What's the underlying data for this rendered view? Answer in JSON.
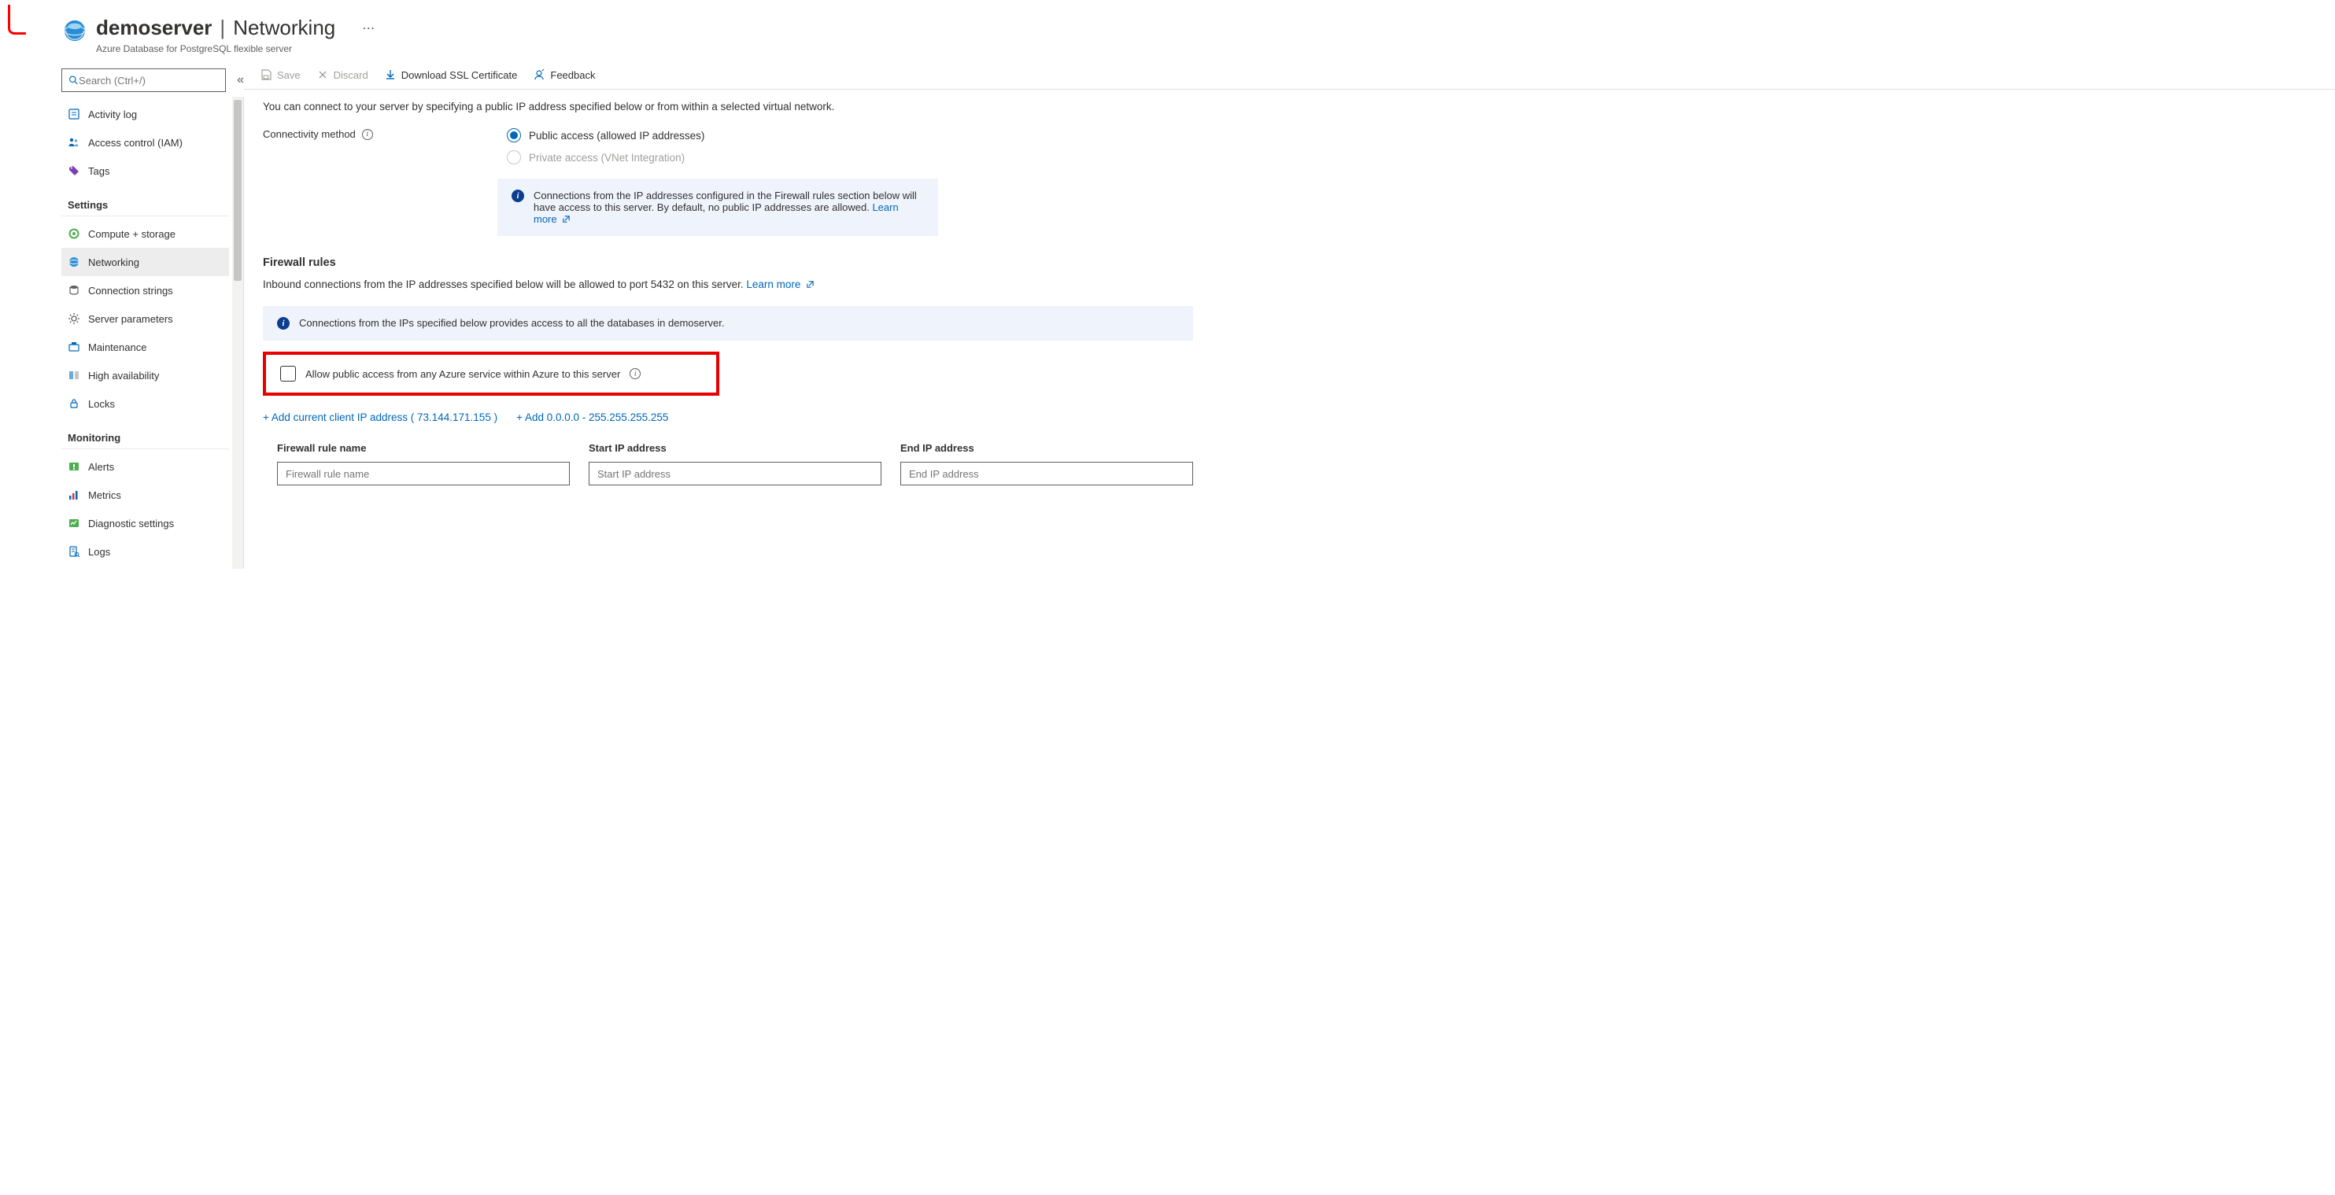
{
  "header": {
    "server_name": "demoserver",
    "separator": "|",
    "page_title": "Networking",
    "subtitle": "Azure Database for PostgreSQL flexible server"
  },
  "sidebar": {
    "search_placeholder": "Search (Ctrl+/)",
    "top_items": [
      {
        "label": "Activity log"
      },
      {
        "label": "Access control (IAM)"
      },
      {
        "label": "Tags"
      }
    ],
    "settings_heading": "Settings",
    "settings_items": [
      {
        "label": "Compute + storage"
      },
      {
        "label": "Networking",
        "active": true
      },
      {
        "label": "Connection strings"
      },
      {
        "label": "Server parameters"
      },
      {
        "label": "Maintenance"
      },
      {
        "label": "High availability"
      },
      {
        "label": "Locks"
      }
    ],
    "monitoring_heading": "Monitoring",
    "monitoring_items": [
      {
        "label": "Alerts"
      },
      {
        "label": "Metrics"
      },
      {
        "label": "Diagnostic settings"
      },
      {
        "label": "Logs"
      }
    ]
  },
  "toolbar": {
    "save": "Save",
    "discard": "Discard",
    "download_cert": "Download SSL Certificate",
    "feedback": "Feedback"
  },
  "content": {
    "intro": "You can connect to your server by specifying a public IP address specified below or from within a selected virtual network.",
    "conn_method_label": "Connectivity method",
    "conn_public": "Public access (allowed IP addresses)",
    "conn_private": "Private access (VNet Integration)",
    "banner1": "Connections from the IP addresses configured in the Firewall rules section below will have access to this server. By default, no public IP addresses are allowed. ",
    "learn_more": "Learn more",
    "firewall_heading": "Firewall rules",
    "firewall_desc_pre": "Inbound connections from the IP addresses specified below will be allowed to port 5432 on this server. ",
    "banner2": "Connections from the IPs specified below provides access to all the databases in demoserver.",
    "allow_azure": "Allow public access from any Azure service within Azure to this server",
    "add_client_ip": "+ Add current client IP address ( 73.144.171.155 )",
    "add_full_range": "+ Add 0.0.0.0 - 255.255.255.255",
    "col_rule_name": "Firewall rule name",
    "col_start_ip": "Start IP address",
    "col_end_ip": "End IP address",
    "ph_rule_name": "Firewall rule name",
    "ph_start_ip": "Start IP address",
    "ph_end_ip": "End IP address"
  }
}
